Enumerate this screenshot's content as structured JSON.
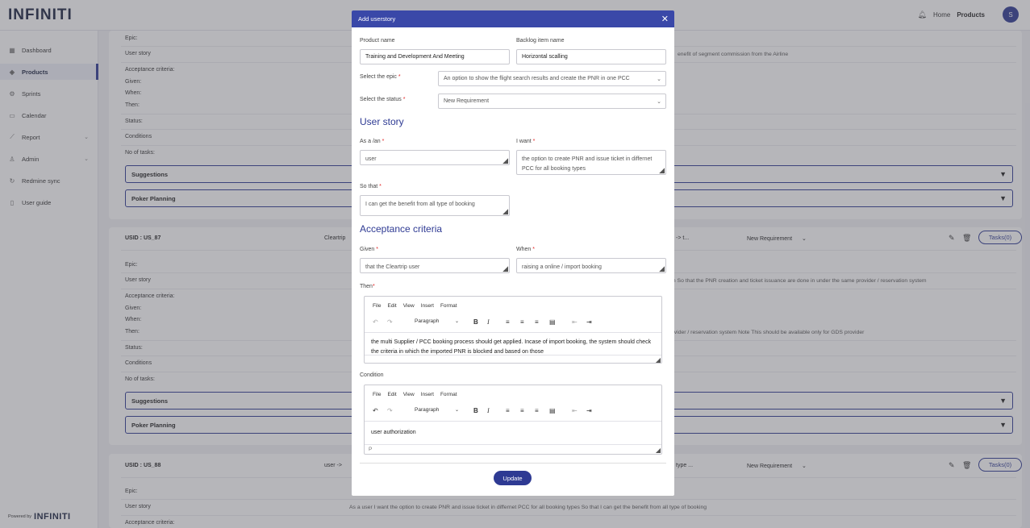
{
  "app": {
    "logo": "INFINITI"
  },
  "topnav": {
    "home": "Home",
    "products": "Products",
    "avatar": "S"
  },
  "sidebar": {
    "items": [
      {
        "label": "Dashboard"
      },
      {
        "label": "Products"
      },
      {
        "label": "Sprints"
      },
      {
        "label": "Calendar"
      },
      {
        "label": "Report"
      },
      {
        "label": "Admin"
      },
      {
        "label": "Redmine sync"
      },
      {
        "label": "User guide"
      }
    ],
    "powered_by": "Powered by",
    "powered_brand": "INFINITI"
  },
  "background": {
    "field_labels": {
      "epic": "Epic:",
      "user_story": "User story",
      "acceptance": "Acceptance criteria:",
      "given": "Given:",
      "when": "When:",
      "then": "Then:",
      "status": "Status:",
      "conditions": "Conditions",
      "no_tasks": "No of tasks:"
    },
    "card1": {
      "user_story_tail": "enefit of segment commission from the Airline",
      "suggestions": "Suggestions",
      "poker": "Poker Planning"
    },
    "card2": {
      "usid": "USID : US_87",
      "title": "Cleartrip",
      "col3": "->  t...",
      "status": "New Requirement",
      "tasks": "Tasks(0)",
      "user_story_tail": "m So that the PNR creation and ticket issuance are done in under the same provider / reservation system",
      "then_tail": "ovider / reservation system Note This should be available only for GDS provider",
      "suggestions": "Suggestions",
      "poker": "Poker Planning"
    },
    "card3": {
      "usid": "USID : US_88",
      "title": "user  ->",
      "col3": "type ...",
      "status": "New Requirement",
      "tasks": "Tasks(0)",
      "user_story_full": "As a user I want the option to create PNR and issue ticket in differnet PCC for all booking types So that I can get the benefit from all type of booking"
    }
  },
  "modal": {
    "title": "Add userstory",
    "product_name_label": "Product name",
    "product_name_value": "Training and Development And Meeting",
    "backlog_label": "Backlog item name",
    "backlog_value": "Horizontal scalling",
    "epic_label": "Select the epic",
    "epic_value": "An option to show the flight search results and create the PNR in one PCC",
    "status_label": "Select the status",
    "status_value": "New Requirement",
    "user_story_heading": "User story",
    "as_a_label": "As a /an",
    "as_a_value": "user",
    "i_want_label": "I want",
    "i_want_value": "the option to create PNR and issue ticket in differnet PCC for all booking types",
    "so_that_label": "So that",
    "so_that_value": "I can get the benefit from all type of booking",
    "acceptance_heading": "Acceptance criteria",
    "given_label": "Given",
    "given_value": "that the Cleartrip user",
    "when_label": "When",
    "when_value": "raising a online / import booking",
    "then_label": "Then",
    "then_value": "the multi Supplier / PCC booking process should get applied. Incase of import booking, the system should check the criteria in which the imported PNR is blocked and based on those",
    "condition_label": "Condition",
    "condition_value": "user authorization",
    "condition_status": "P",
    "editor_menu": [
      "File",
      "Edit",
      "View",
      "Insert",
      "Format"
    ],
    "editor_block": "Paragraph",
    "update_button": "Update"
  },
  "colors": {
    "primary": "#2e3a93",
    "modal_header": "#3a48a8",
    "required": "#e02424"
  }
}
